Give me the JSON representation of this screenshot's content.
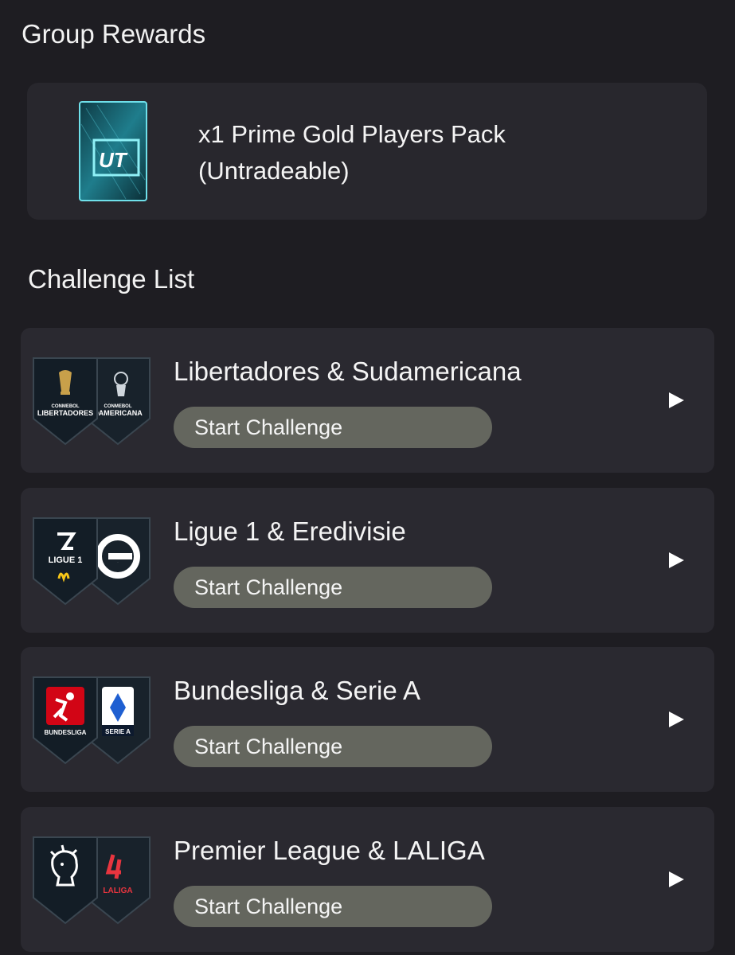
{
  "group_rewards": {
    "title": "Group Rewards",
    "reward_line1": "x1 Prime Gold Players Pack",
    "reward_line2": "(Untradeable)",
    "pack_label": "UT"
  },
  "challenge_list": {
    "title": "Challenge List",
    "items": [
      {
        "title": "Libertadores & Sudamericana",
        "button": "Start Challenge",
        "badge_front": "LIBERTADORES",
        "badge_front_sub": "CONMEBOL",
        "badge_back": "DAMERICANA",
        "badge_back_sub": "CONMEBOL"
      },
      {
        "title": "Ligue 1 & Eredivisie",
        "button": "Start Challenge",
        "badge_front": "LIGUE 1",
        "badge_back": "e"
      },
      {
        "title": "Bundesliga & Serie A",
        "button": "Start Challenge",
        "badge_front": "BUNDESLIGA",
        "badge_back": "SERIE A"
      },
      {
        "title": "Premier League & LALIGA",
        "button": "Start Challenge",
        "badge_front": "",
        "badge_back": "LALIGA"
      }
    ]
  },
  "colors": {
    "background": "#1e1d22",
    "card": "#2a2930",
    "button": "#64665e",
    "pack_accent": "#5fd4e0"
  }
}
